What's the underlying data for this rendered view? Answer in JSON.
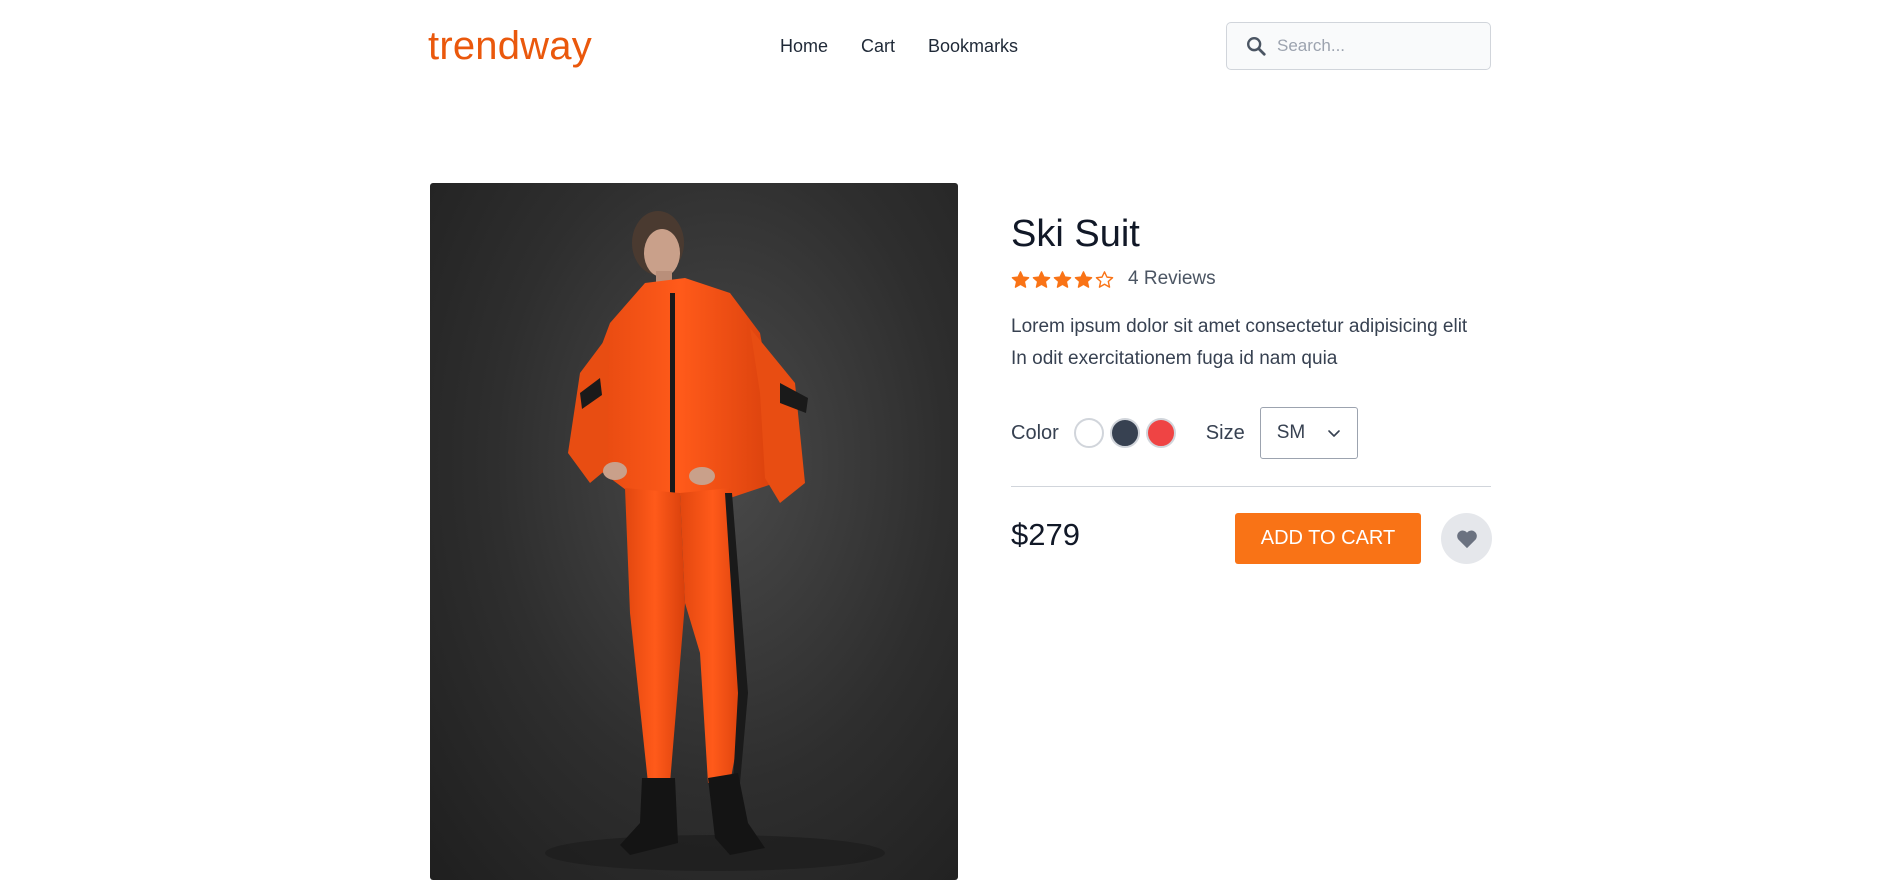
{
  "header": {
    "logo": "trendway",
    "nav": [
      "Home",
      "Cart",
      "Bookmarks"
    ],
    "search": {
      "placeholder": "Search...",
      "value": "",
      "icon": "search-icon"
    }
  },
  "product": {
    "image_alt": "woman wearing orange ski suit",
    "title": "Ski Suit",
    "rating": 4,
    "rating_max": 5,
    "reviews_label": "4 Reviews",
    "description": "Lorem ipsum dolor sit amet consectetur adipisicing elit In odit exercitationem fuga id nam quia",
    "color_label": "Color",
    "colors": [
      "#ffffff",
      "#374151",
      "#ef4444"
    ],
    "size_label": "Size",
    "size_value": "SM",
    "price": "$279",
    "add_to_cart_label": "ADD TO CART",
    "bookmark_icon": "heart-icon"
  },
  "theme": {
    "brand": "#ea580c",
    "accent": "#f97316",
    "star": "#f97316"
  }
}
